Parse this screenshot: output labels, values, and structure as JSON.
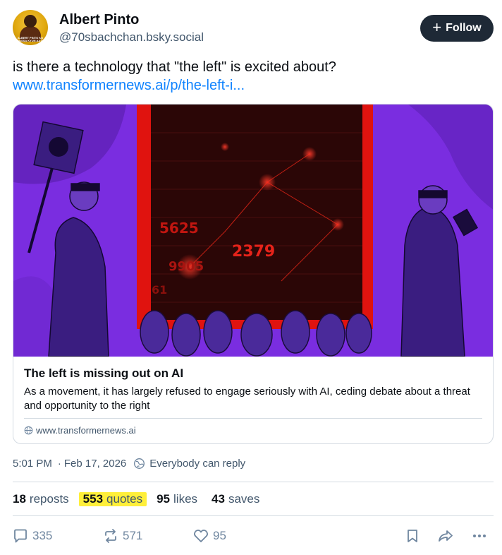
{
  "post": {
    "author_name": "Albert Pinto",
    "author_handle": "@70sbachchan.bsky.social",
    "avatar_caption": "ALBERT PINTO KO GUSSA KYUN AATA HAI",
    "follow_label": "Follow",
    "text": "is there a technology that \"the left\" is excited about?",
    "link": "www.transformernews.ai/p/the-left-i..."
  },
  "card": {
    "title": "The left is missing out on AI",
    "description": "As a movement, it has largely refused to engage seriously with AI, ceding debate about a threat and opportunity to the right",
    "domain": "www.transformernews.ai",
    "image_numbers": [
      "5625",
      "2379",
      "9905",
      "61"
    ]
  },
  "meta": {
    "time": "5:01 PM",
    "date": "Feb 17, 2026",
    "reply_setting": "Everybody can reply"
  },
  "stats": {
    "reposts_count": "18",
    "reposts_label": "reposts",
    "quotes_count": "553",
    "quotes_label": "quotes",
    "likes_count": "95",
    "likes_label": "likes",
    "saves_count": "43",
    "saves_label": "saves"
  },
  "actions": {
    "replies": "335",
    "reposts": "571",
    "likes": "95"
  },
  "colors": {
    "link": "#1083fe",
    "highlight": "#ffef3a",
    "follow_bg": "#1e2936",
    "image_purple": "#7a2de0",
    "image_red": "#e0130f"
  }
}
